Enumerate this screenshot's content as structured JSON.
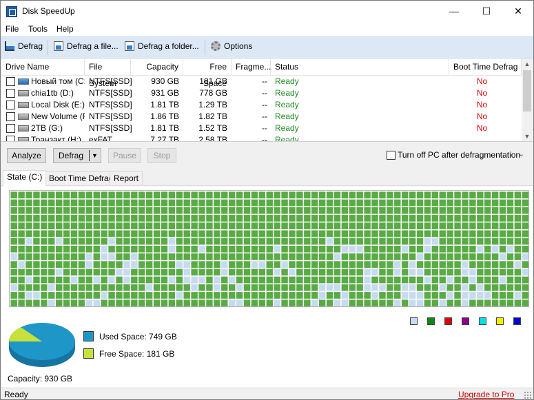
{
  "window": {
    "title": "Disk SpeedUp",
    "min_glyph": "—",
    "max_glyph": "☐",
    "close_glyph": "✕"
  },
  "menu": [
    "File",
    "Tools",
    "Help"
  ],
  "toolbar": {
    "defrag": "Defrag",
    "defrag_file": "Defrag a file...",
    "defrag_folder": "Defrag a folder...",
    "options": "Options"
  },
  "table": {
    "columns": [
      "Drive Name",
      "File System",
      "Capacity",
      "Free Space",
      "Fragme...",
      "Status",
      "Boot Time Defrag"
    ],
    "rows": [
      {
        "name": "Новый том (C:)",
        "fs": "NTFS[SSD]",
        "capacity": "930 GB",
        "free": "181 GB",
        "frag": "--",
        "status": "Ready",
        "boot": "No",
        "icon": "system-drive-icon"
      },
      {
        "name": "chia1tb (D:)",
        "fs": "NTFS[SSD]",
        "capacity": "931 GB",
        "free": "778 GB",
        "frag": "--",
        "status": "Ready",
        "boot": "No",
        "icon": "drive-icon"
      },
      {
        "name": "Local Disk (E:)",
        "fs": "NTFS[SSD]",
        "capacity": "1.81 TB",
        "free": "1.29 TB",
        "frag": "--",
        "status": "Ready",
        "boot": "No",
        "icon": "drive-icon"
      },
      {
        "name": "New Volume (F:)",
        "fs": "NTFS[SSD]",
        "capacity": "1.86 TB",
        "free": "1.82 TB",
        "frag": "--",
        "status": "Ready",
        "boot": "No",
        "icon": "drive-icon"
      },
      {
        "name": "2TB (G:)",
        "fs": "NTFS[SSD]",
        "capacity": "1.81 TB",
        "free": "1.52 TB",
        "frag": "--",
        "status": "Ready",
        "boot": "No",
        "icon": "drive-icon"
      },
      {
        "name": "Транзакт (H:)",
        "fs": "exFAT",
        "capacity": "7.27 TB",
        "free": "2.58 TB",
        "frag": "--",
        "status": "Ready",
        "boot": "",
        "icon": "drive-icon"
      }
    ]
  },
  "actions": {
    "analyze": "Analyze",
    "defrag": "Defrag",
    "pause": "Pause",
    "stop": "Stop",
    "turn_off": "Turn off PC after defragmentation",
    "chevron": "⌄"
  },
  "tabs": [
    "State (C:)",
    "Boot Time Defrag",
    "Report"
  ],
  "cluster_map": {
    "cols": 69,
    "rows": 15,
    "used_color": "#5aaa46",
    "free_color": "#c6daf0",
    "free_fraction": 0.12
  },
  "legend_colors": [
    "#c6daf0",
    "#0a8a0a",
    "#e00000",
    "#8b008b",
    "#00e0e0",
    "#f0f000",
    "#0000d0"
  ],
  "disk": {
    "used_label": "Used Space: 749 GB",
    "free_label": "Free Space: 181 GB",
    "capacity_label": "Capacity: 930 GB",
    "used_gb": 749,
    "free_gb": 181,
    "used_color": "#1e96c8",
    "free_color": "#c8e03c"
  },
  "statusbar": {
    "status": "Ready",
    "upgrade": "Upgrade to Pro"
  }
}
